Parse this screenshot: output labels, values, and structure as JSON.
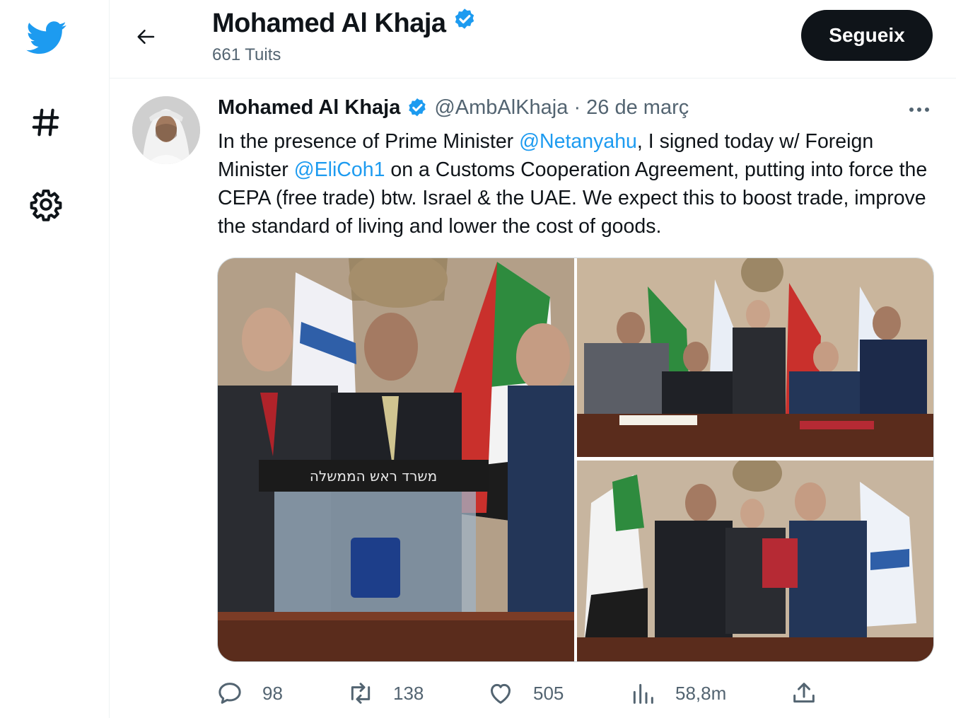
{
  "sidebar": {
    "items": [
      {
        "icon": "twitter-bird-icon"
      },
      {
        "icon": "hashtag-icon"
      },
      {
        "icon": "gear-icon"
      }
    ]
  },
  "header": {
    "back_icon": "arrow-left-icon",
    "name": "Mohamed Al Khaja",
    "verified_icon": "verified-badge-icon",
    "tweet_count": "661 Tuits",
    "follow_label": "Segueix"
  },
  "tweet": {
    "author_name": "Mohamed Al Khaja",
    "handle": "@AmbAlKhaja",
    "separator": " · ",
    "date": "26 de març",
    "text_parts": {
      "p1": "In the presence of Prime Minister ",
      "m1": "@Netanyahu",
      "p2": ", I signed today w/ Foreign Minister ",
      "m2": "@EliCoh1",
      "p3": " on a Customs Cooperation Agreement, putting into force the CEPA (free trade) btw. Israel & the UAE. We expect this to boost trade, improve the standard of living and lower the cost of goods."
    },
    "podium_text": "משרד ראש הממשלה"
  },
  "actions": {
    "replies": "98",
    "retweets": "138",
    "likes": "505",
    "views": "58,8m"
  },
  "colors": {
    "accent": "#1d9bf0",
    "text": "#0f1419",
    "muted": "#536471",
    "follow_bg": "#0f1419"
  }
}
